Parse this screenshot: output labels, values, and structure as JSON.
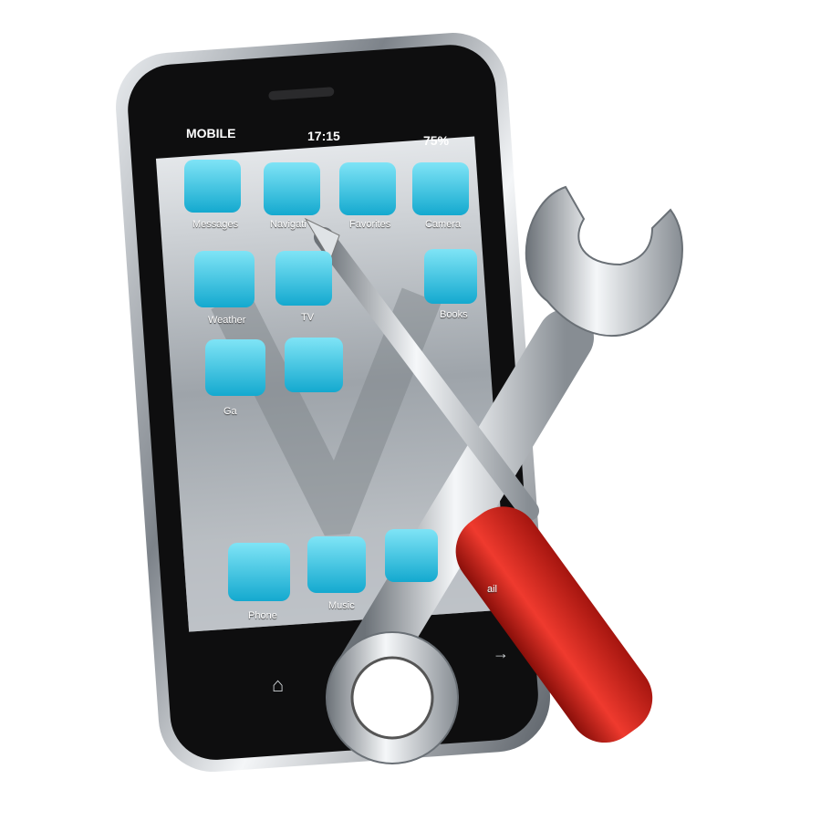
{
  "status_bar": {
    "carrier": "MOBILE",
    "time": "17:15",
    "battery": "75%"
  },
  "apps": [
    {
      "label": "Messages",
      "icon": "speech-bubble-icon"
    },
    {
      "label": "Navigati",
      "icon": "map-pin-icon"
    },
    {
      "label": "Favorites",
      "icon": "star-icon"
    },
    {
      "label": "Camera",
      "icon": "camera-icon"
    },
    {
      "label": "Weather",
      "icon": "sun-icon"
    },
    {
      "label": "TV",
      "icon": "tv-icon"
    },
    {
      "label": "Books",
      "icon": "book-icon"
    },
    {
      "label": "Ga",
      "icon": "gamepad-icon"
    },
    {
      "label": "",
      "icon": "gears-icon"
    }
  ],
  "dock": [
    {
      "label": "Phone",
      "icon": "phone-handset-icon"
    },
    {
      "label": "Music",
      "icon": "music-note-icon"
    },
    {
      "label": "",
      "icon": "globe-icon"
    },
    {
      "label": "ail",
      "icon": "mail-icon"
    }
  ],
  "nav_buttons": [
    "home-icon",
    "back-icon",
    "forward-icon"
  ],
  "colors": {
    "icon_tile": "#2fc8e6",
    "screwdriver_handle": "#d7261d",
    "wrench": "#c9cdd2",
    "phone_body": "#111111"
  }
}
